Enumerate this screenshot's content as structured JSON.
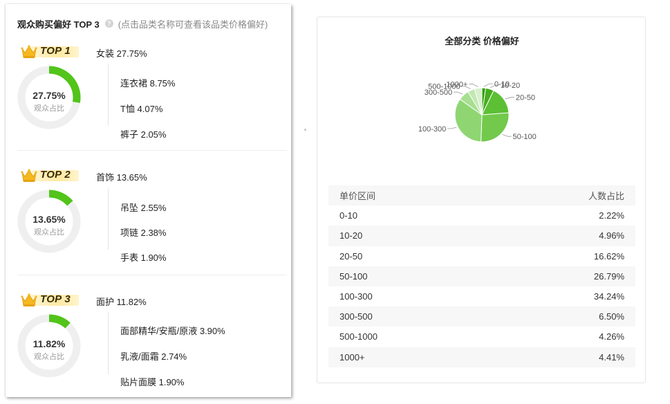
{
  "left": {
    "title": "观众购买偏好 TOP 3",
    "hint": "(点击品类名称可查看该品类价格偏好)",
    "ranks": [
      {
        "badge": "TOP 1",
        "category": "女装 27.75%",
        "percent_text": "27.75%",
        "percent_value": 27.75,
        "ratio_label": "观众占比",
        "subs": [
          "连衣裙 8.75%",
          "T恤 4.07%",
          "裤子 2.05%"
        ]
      },
      {
        "badge": "TOP 2",
        "category": "首饰 13.65%",
        "percent_text": "13.65%",
        "percent_value": 13.65,
        "ratio_label": "观众占比",
        "subs": [
          "吊坠 2.55%",
          "项链 2.38%",
          "手表 1.90%"
        ]
      },
      {
        "badge": "TOP 3",
        "category": "面护 11.82%",
        "percent_text": "11.82%",
        "percent_value": 11.82,
        "ratio_label": "观众占比",
        "subs": [
          "面部精华/安瓶/原液 3.90%",
          "乳液/面霜 2.74%",
          "贴片面膜 1.90%"
        ]
      }
    ],
    "colors": {
      "ring_fill": "#52c41a",
      "ring_track": "#efefef",
      "crown": "#f5b820"
    }
  },
  "right": {
    "title": "全部分类 价格偏好",
    "table_headers": [
      "单价区间",
      "人数占比"
    ],
    "rows": [
      [
        "0-10",
        "2.22%"
      ],
      [
        "10-20",
        "4.96%"
      ],
      [
        "20-50",
        "16.62%"
      ],
      [
        "50-100",
        "26.79%"
      ],
      [
        "100-300",
        "34.24%"
      ],
      [
        "300-500",
        "6.50%"
      ],
      [
        "500-1000",
        "4.26%"
      ],
      [
        "1000+",
        "4.41%"
      ]
    ]
  },
  "chart_data": {
    "type": "pie",
    "title": "全部分类 价格偏好",
    "categories": [
      "0-10",
      "10-20",
      "20-50",
      "50-100",
      "100-300",
      "300-500",
      "500-1000",
      "1000+"
    ],
    "values": [
      2.22,
      4.96,
      16.62,
      26.79,
      34.24,
      6.5,
      4.26,
      4.41
    ],
    "colors": [
      "#2e9e0c",
      "#46ad1f",
      "#5cbf34",
      "#72c94c",
      "#8fd672",
      "#a8df92",
      "#c2e8b2",
      "#d7f0cc"
    ]
  }
}
